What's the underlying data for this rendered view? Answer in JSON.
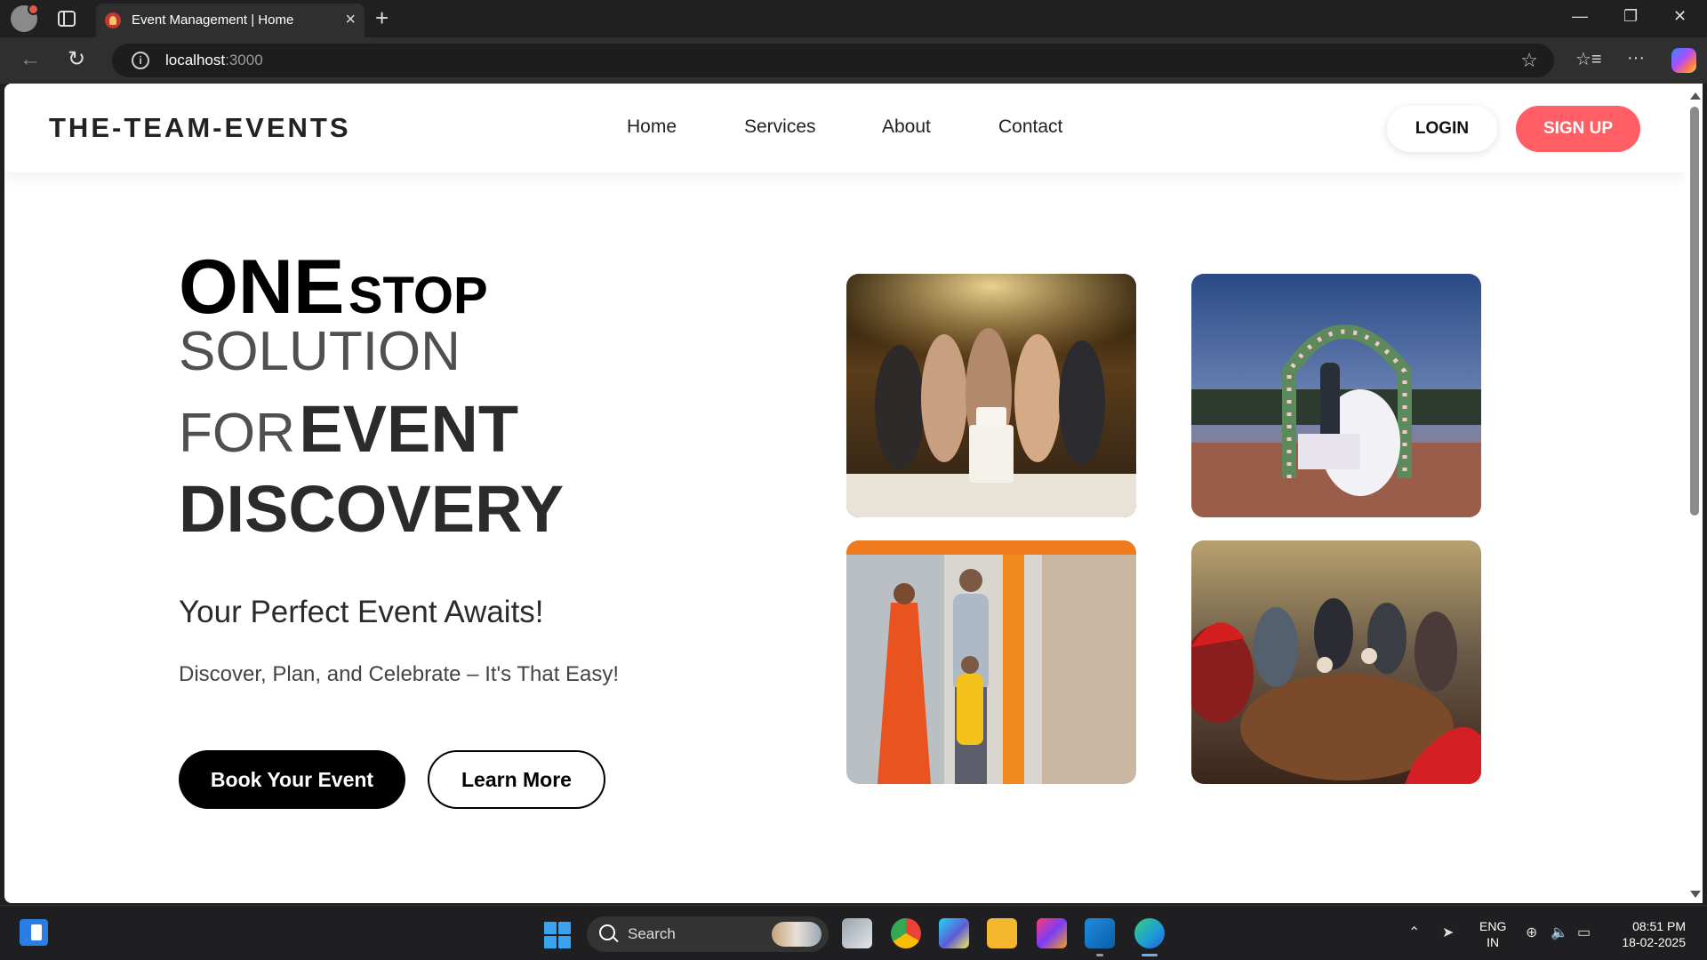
{
  "browser": {
    "tab_title": "Event Management | Home",
    "url_host": "localhost",
    "url_port": ":3000",
    "icons": [
      "profile-avatar",
      "tabs-icon",
      "back-arrow",
      "refresh",
      "site-info",
      "favorite-star",
      "favorites-list",
      "more-menu",
      "copilot"
    ]
  },
  "site": {
    "logo": "THE-TEAM-EVENTS",
    "nav": [
      "Home",
      "Services",
      "About",
      "Contact"
    ],
    "login_label": "LOGIN",
    "signup_label": "SIGN UP",
    "accent_color": "#ff5f64"
  },
  "hero": {
    "line1_word1": "ONE",
    "line1_word2": "STOP",
    "line2": "SOLUTION",
    "line3_word1": "FOR",
    "line3_word2": "EVENT",
    "line4": "DISCOVERY",
    "tagline": "Your Perfect Event Awaits!",
    "subline": "Discover, Plan, and Celebrate – It's That Easy!",
    "primary_cta": "Book Your Event",
    "secondary_cta": "Learn More"
  },
  "gallery": [
    {
      "subject": "birthday-party-photo"
    },
    {
      "subject": "wedding-ceremony-photo"
    },
    {
      "subject": "family-festival-photo"
    },
    {
      "subject": "christmas-dinner-photo"
    }
  ],
  "taskbar": {
    "search_label": "Search",
    "lang_line1": "ENG",
    "lang_line2": "IN",
    "time": "08:51 PM",
    "date": "18-02-2025"
  }
}
